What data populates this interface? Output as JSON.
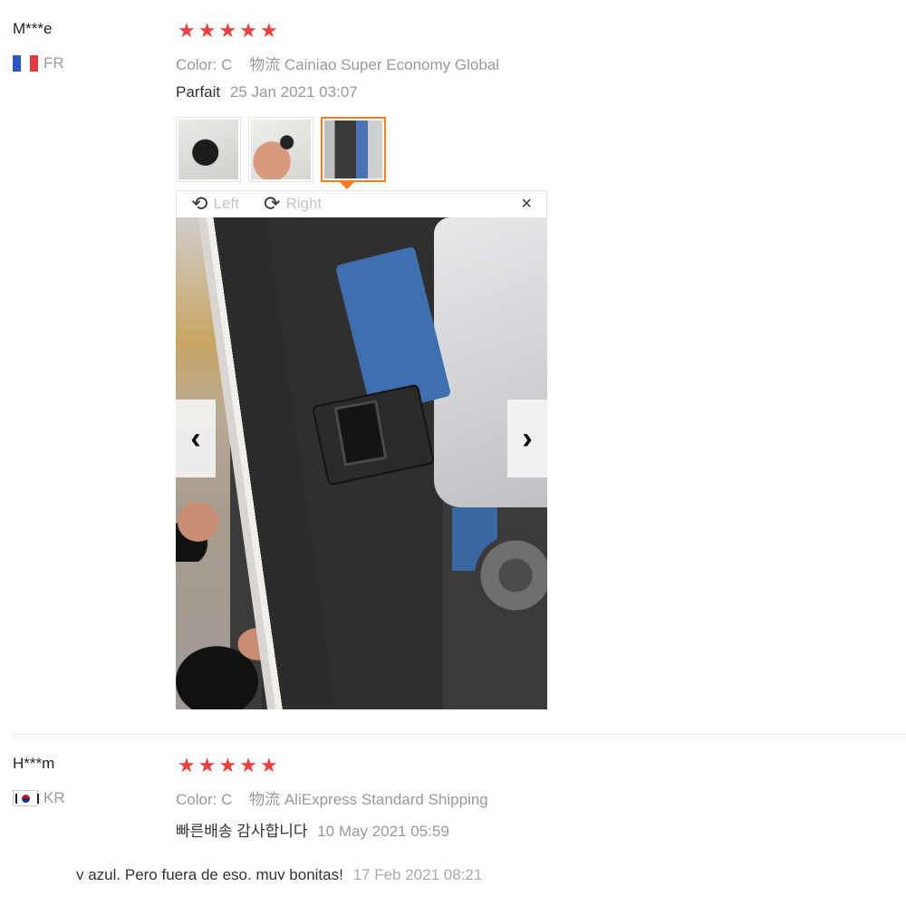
{
  "reviews": [
    {
      "user": "M***e",
      "country": "FR",
      "rating": 5,
      "color_label": "Color:",
      "color_value": "C",
      "shipping_label": "物流",
      "shipping_value": "Cainiao Super Economy Global",
      "feedback": "Parfait",
      "date": "25 Jan 2021 03:07",
      "viewer": {
        "rotate_left": "Left",
        "rotate_right": "Right",
        "close": "×",
        "selected_thumbnail": 3,
        "thumbnail_count": 3
      }
    },
    {
      "user": "H***m",
      "country": "KR",
      "rating": 5,
      "color_label": "Color:",
      "color_value": "C",
      "shipping_label": "物流",
      "shipping_value": "AliExpress Standard Shipping",
      "feedback": "빠른배송 감사합니다",
      "date": "10 May 2021 05:59"
    }
  ],
  "partial_line": {
    "text": "y azul. Pero fuera de eso, muy bonitas!",
    "date": "17 Feb 2021 08:21"
  },
  "icons": {
    "star": "star-icon",
    "rotate_left": "rotate-left-icon",
    "rotate_right": "rotate-right-icon",
    "prev": "chevron-left-icon",
    "next": "chevron-right-icon"
  },
  "colors": {
    "star": "#ef3e3e",
    "active_thumb": "#ff7a1a",
    "muted_text": "#999999"
  }
}
